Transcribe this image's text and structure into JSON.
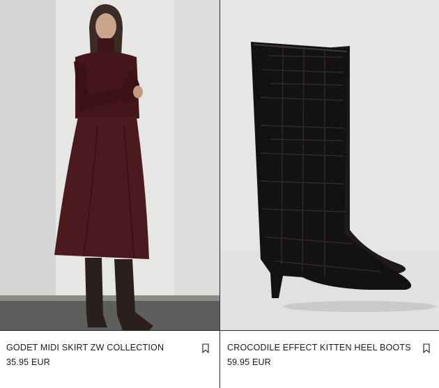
{
  "products": [
    {
      "name": "GODET MIDI SKIRT ZW COLLECTION",
      "price": "35.95 EUR",
      "bookmark_icon": "bookmark-icon"
    },
    {
      "name": "CROCODILE EFFECT KITTEN HEEL BOOTS",
      "price": "59.95 EUR",
      "bookmark_icon": "bookmark-icon"
    }
  ],
  "colors": {
    "border": "#2a2a2a",
    "text": "#1a1a1a",
    "background": "#ffffff"
  }
}
